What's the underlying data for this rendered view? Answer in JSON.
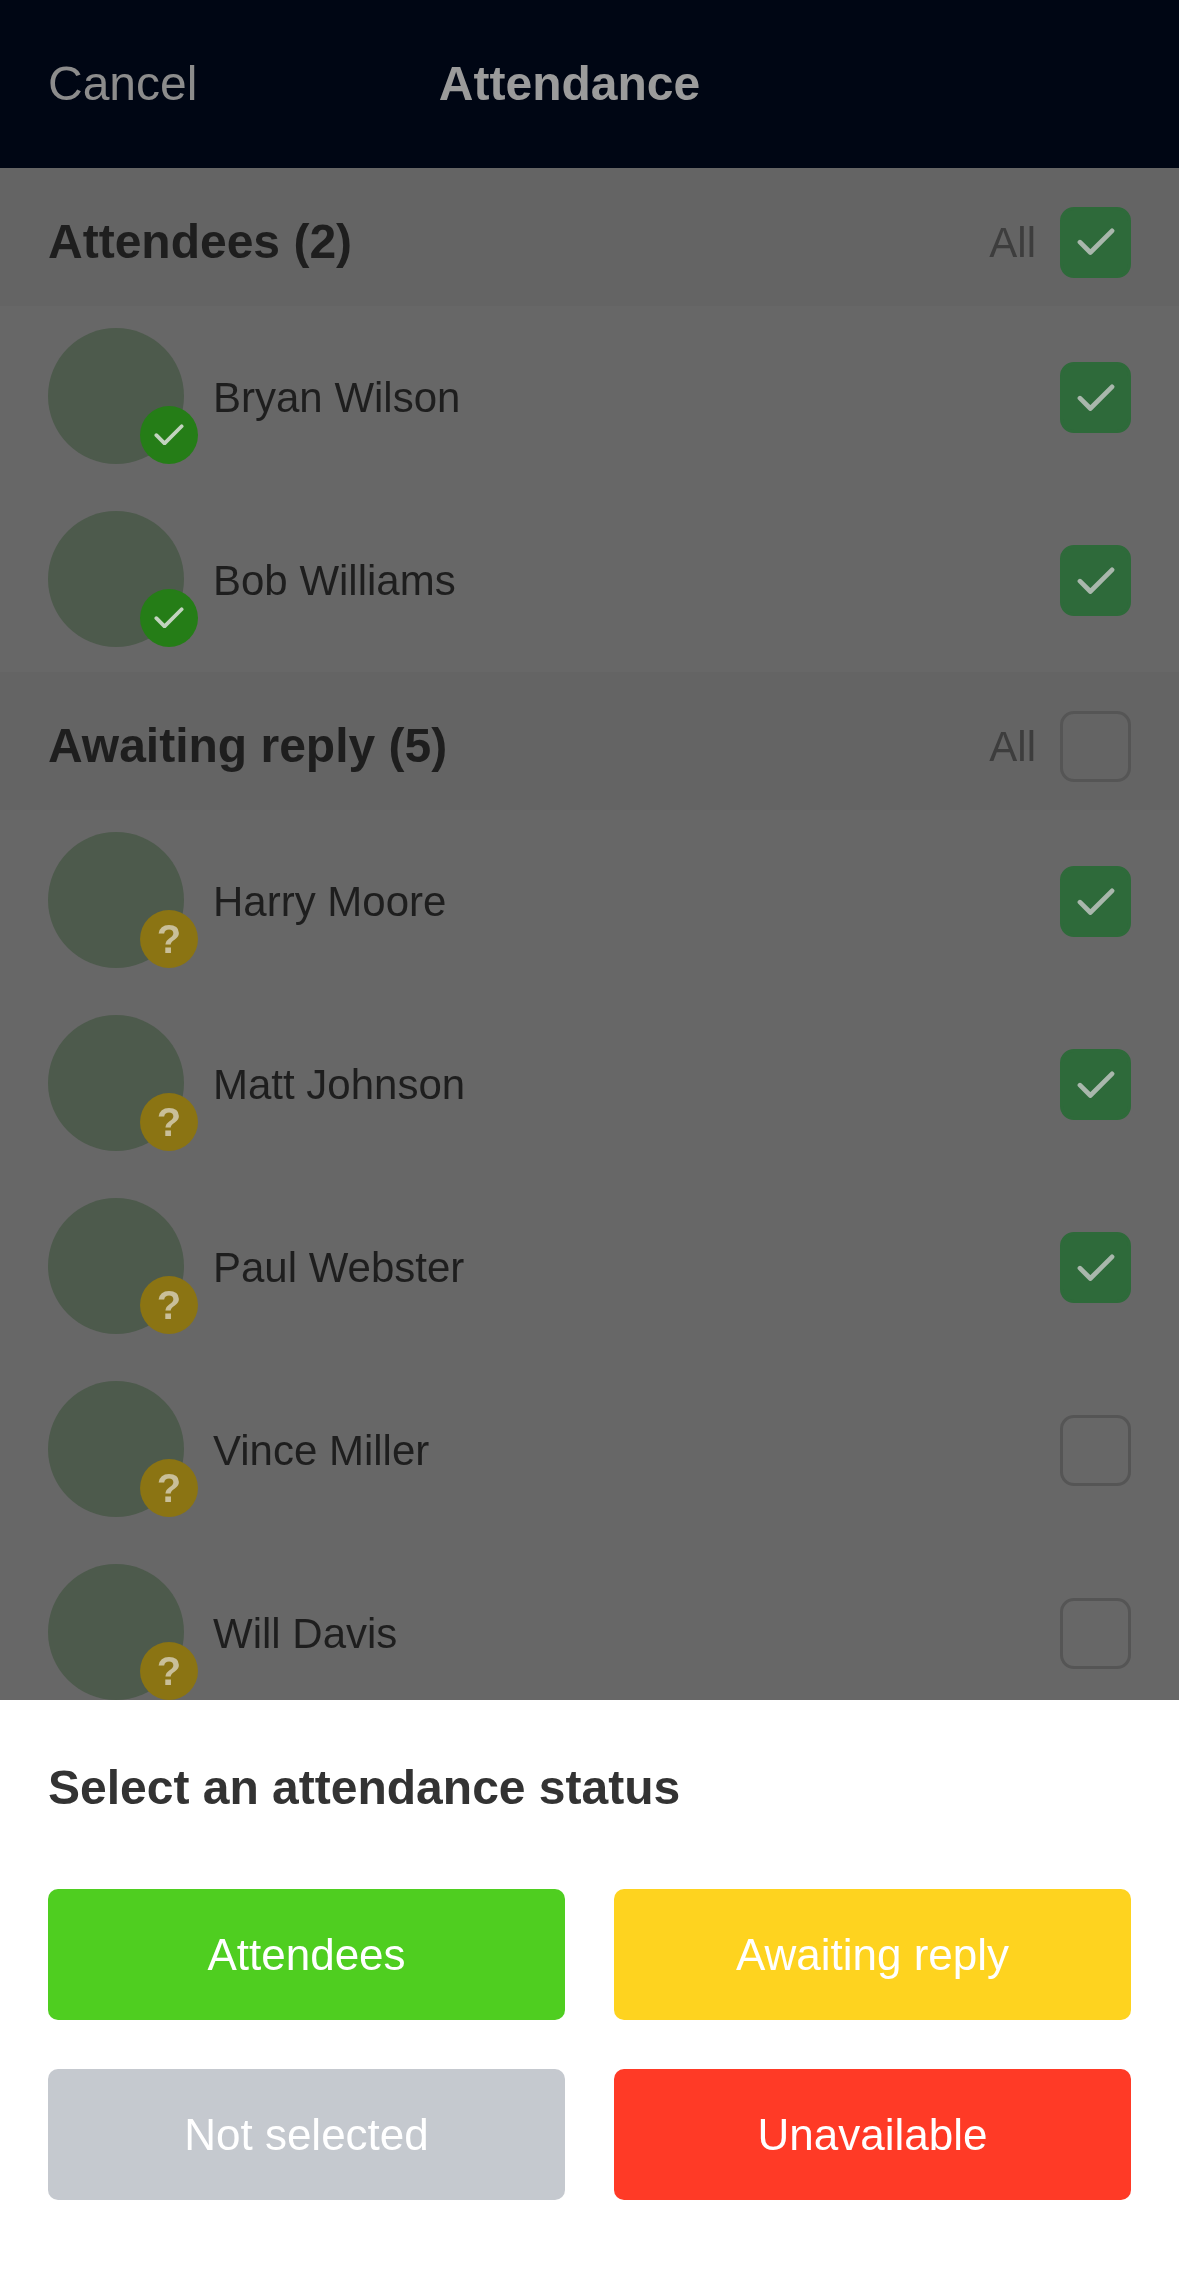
{
  "header": {
    "cancel": "Cancel",
    "title": "Attendance"
  },
  "sections": [
    {
      "title": "Attendees (2)",
      "all_label": "All",
      "all_checked": true,
      "people": [
        {
          "name": "Bryan Wilson",
          "kind": "attending",
          "checked": true
        },
        {
          "name": "Bob Williams",
          "kind": "attending",
          "checked": true
        }
      ]
    },
    {
      "title": "Awaiting reply (5)",
      "all_label": "All",
      "all_checked": false,
      "people": [
        {
          "name": "Harry Moore",
          "kind": "awaiting",
          "badge": "?",
          "checked": true
        },
        {
          "name": "Matt Johnson",
          "kind": "awaiting",
          "badge": "?",
          "checked": true
        },
        {
          "name": "Paul Webster",
          "kind": "awaiting",
          "badge": "?",
          "checked": true
        },
        {
          "name": "Vince Miller",
          "kind": "awaiting",
          "badge": "?",
          "checked": false
        },
        {
          "name": "Will Davis",
          "kind": "awaiting",
          "badge": "?",
          "checked": false
        }
      ]
    }
  ],
  "sheet": {
    "title": "Select an attendance status",
    "buttons": [
      {
        "label": "Attendees",
        "color": "#4fce20"
      },
      {
        "label": "Awaiting reply",
        "color": "#fed31f"
      },
      {
        "label": "Not selected",
        "color": "#c5c9cf"
      },
      {
        "label": "Unavailable",
        "color": "#ff3a26"
      }
    ]
  }
}
